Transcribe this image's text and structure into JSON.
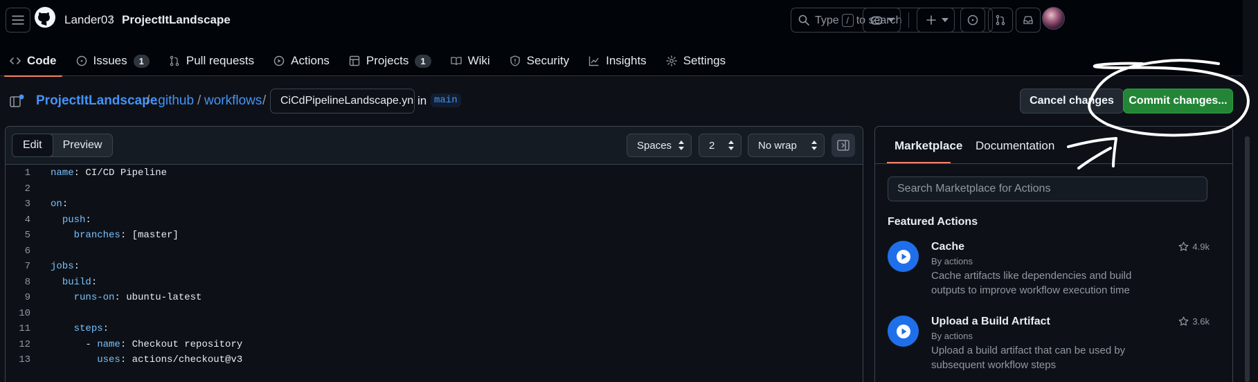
{
  "header": {
    "owner": "Lander03",
    "separator": "/",
    "repo": "ProjectItLandscape",
    "search_text_before": "Type",
    "search_key": "/",
    "search_text_after": "to search"
  },
  "tabs": [
    {
      "label": "Code",
      "icon": "code-icon",
      "active": true
    },
    {
      "label": "Issues",
      "icon": "issue-icon",
      "count": "1"
    },
    {
      "label": "Pull requests",
      "icon": "pull-request-icon"
    },
    {
      "label": "Actions",
      "icon": "play-icon"
    },
    {
      "label": "Projects",
      "icon": "table-icon",
      "count": "1"
    },
    {
      "label": "Wiki",
      "icon": "book-icon"
    },
    {
      "label": "Security",
      "icon": "shield-icon"
    },
    {
      "label": "Insights",
      "icon": "graph-icon"
    },
    {
      "label": "Settings",
      "icon": "gear-icon"
    }
  ],
  "path": {
    "repo": "ProjectItLandscape",
    "sep": "/",
    "dir1": ".github",
    "dir2": "workflows",
    "filename": "CiCdPipelineLandscape.yn",
    "in_label": "in",
    "branch": "main"
  },
  "actions": {
    "cancel": "Cancel changes",
    "commit": "Commit changes..."
  },
  "editor": {
    "mode_edit": "Edit",
    "mode_preview": "Preview",
    "indent_mode": "Spaces",
    "indent_size": "2",
    "wrap_mode": "No wrap",
    "lines": [
      {
        "n": "1",
        "indent": "",
        "key": "name",
        "rest": ": CI/CD Pipeline"
      },
      {
        "n": "2",
        "indent": "",
        "key": "",
        "rest": ""
      },
      {
        "n": "3",
        "indent": "",
        "key": "on",
        "rest": ":"
      },
      {
        "n": "4",
        "indent": "  ",
        "key": "push",
        "rest": ":"
      },
      {
        "n": "5",
        "indent": "    ",
        "key": "branches",
        "rest": ": [master]"
      },
      {
        "n": "6",
        "indent": "",
        "key": "",
        "rest": ""
      },
      {
        "n": "7",
        "indent": "",
        "key": "jobs",
        "rest": ":"
      },
      {
        "n": "8",
        "indent": "  ",
        "key": "build",
        "rest": ":"
      },
      {
        "n": "9",
        "indent": "    ",
        "key": "runs-on",
        "rest": ": ubuntu-latest"
      },
      {
        "n": "10",
        "indent": "",
        "key": "",
        "rest": ""
      },
      {
        "n": "11",
        "indent": "    ",
        "key": "steps",
        "rest": ":"
      },
      {
        "n": "12",
        "indent": "      - ",
        "key": "name",
        "rest": ": Checkout repository"
      },
      {
        "n": "13",
        "indent": "        ",
        "key": "uses",
        "rest": ": actions/checkout@v3"
      }
    ]
  },
  "marketplace": {
    "tab_marketplace": "Marketplace",
    "tab_documentation": "Documentation",
    "search_placeholder": "Search Marketplace for Actions",
    "featured_title": "Featured Actions",
    "items": [
      {
        "name": "Cache",
        "by": "By actions",
        "description": "Cache artifacts like dependencies and build outputs to improve workflow execution time",
        "stars": "4.9k"
      },
      {
        "name": "Upload a Build Artifact",
        "by": "By actions",
        "description": "Upload a build artifact that can be used by subsequent workflow steps",
        "stars": "3.6k"
      }
    ]
  },
  "colors": {
    "accent_blue": "#4493f8",
    "commit_green": "#238636",
    "tab_underline": "#f78166",
    "annotation_stroke": "#ffffff"
  }
}
